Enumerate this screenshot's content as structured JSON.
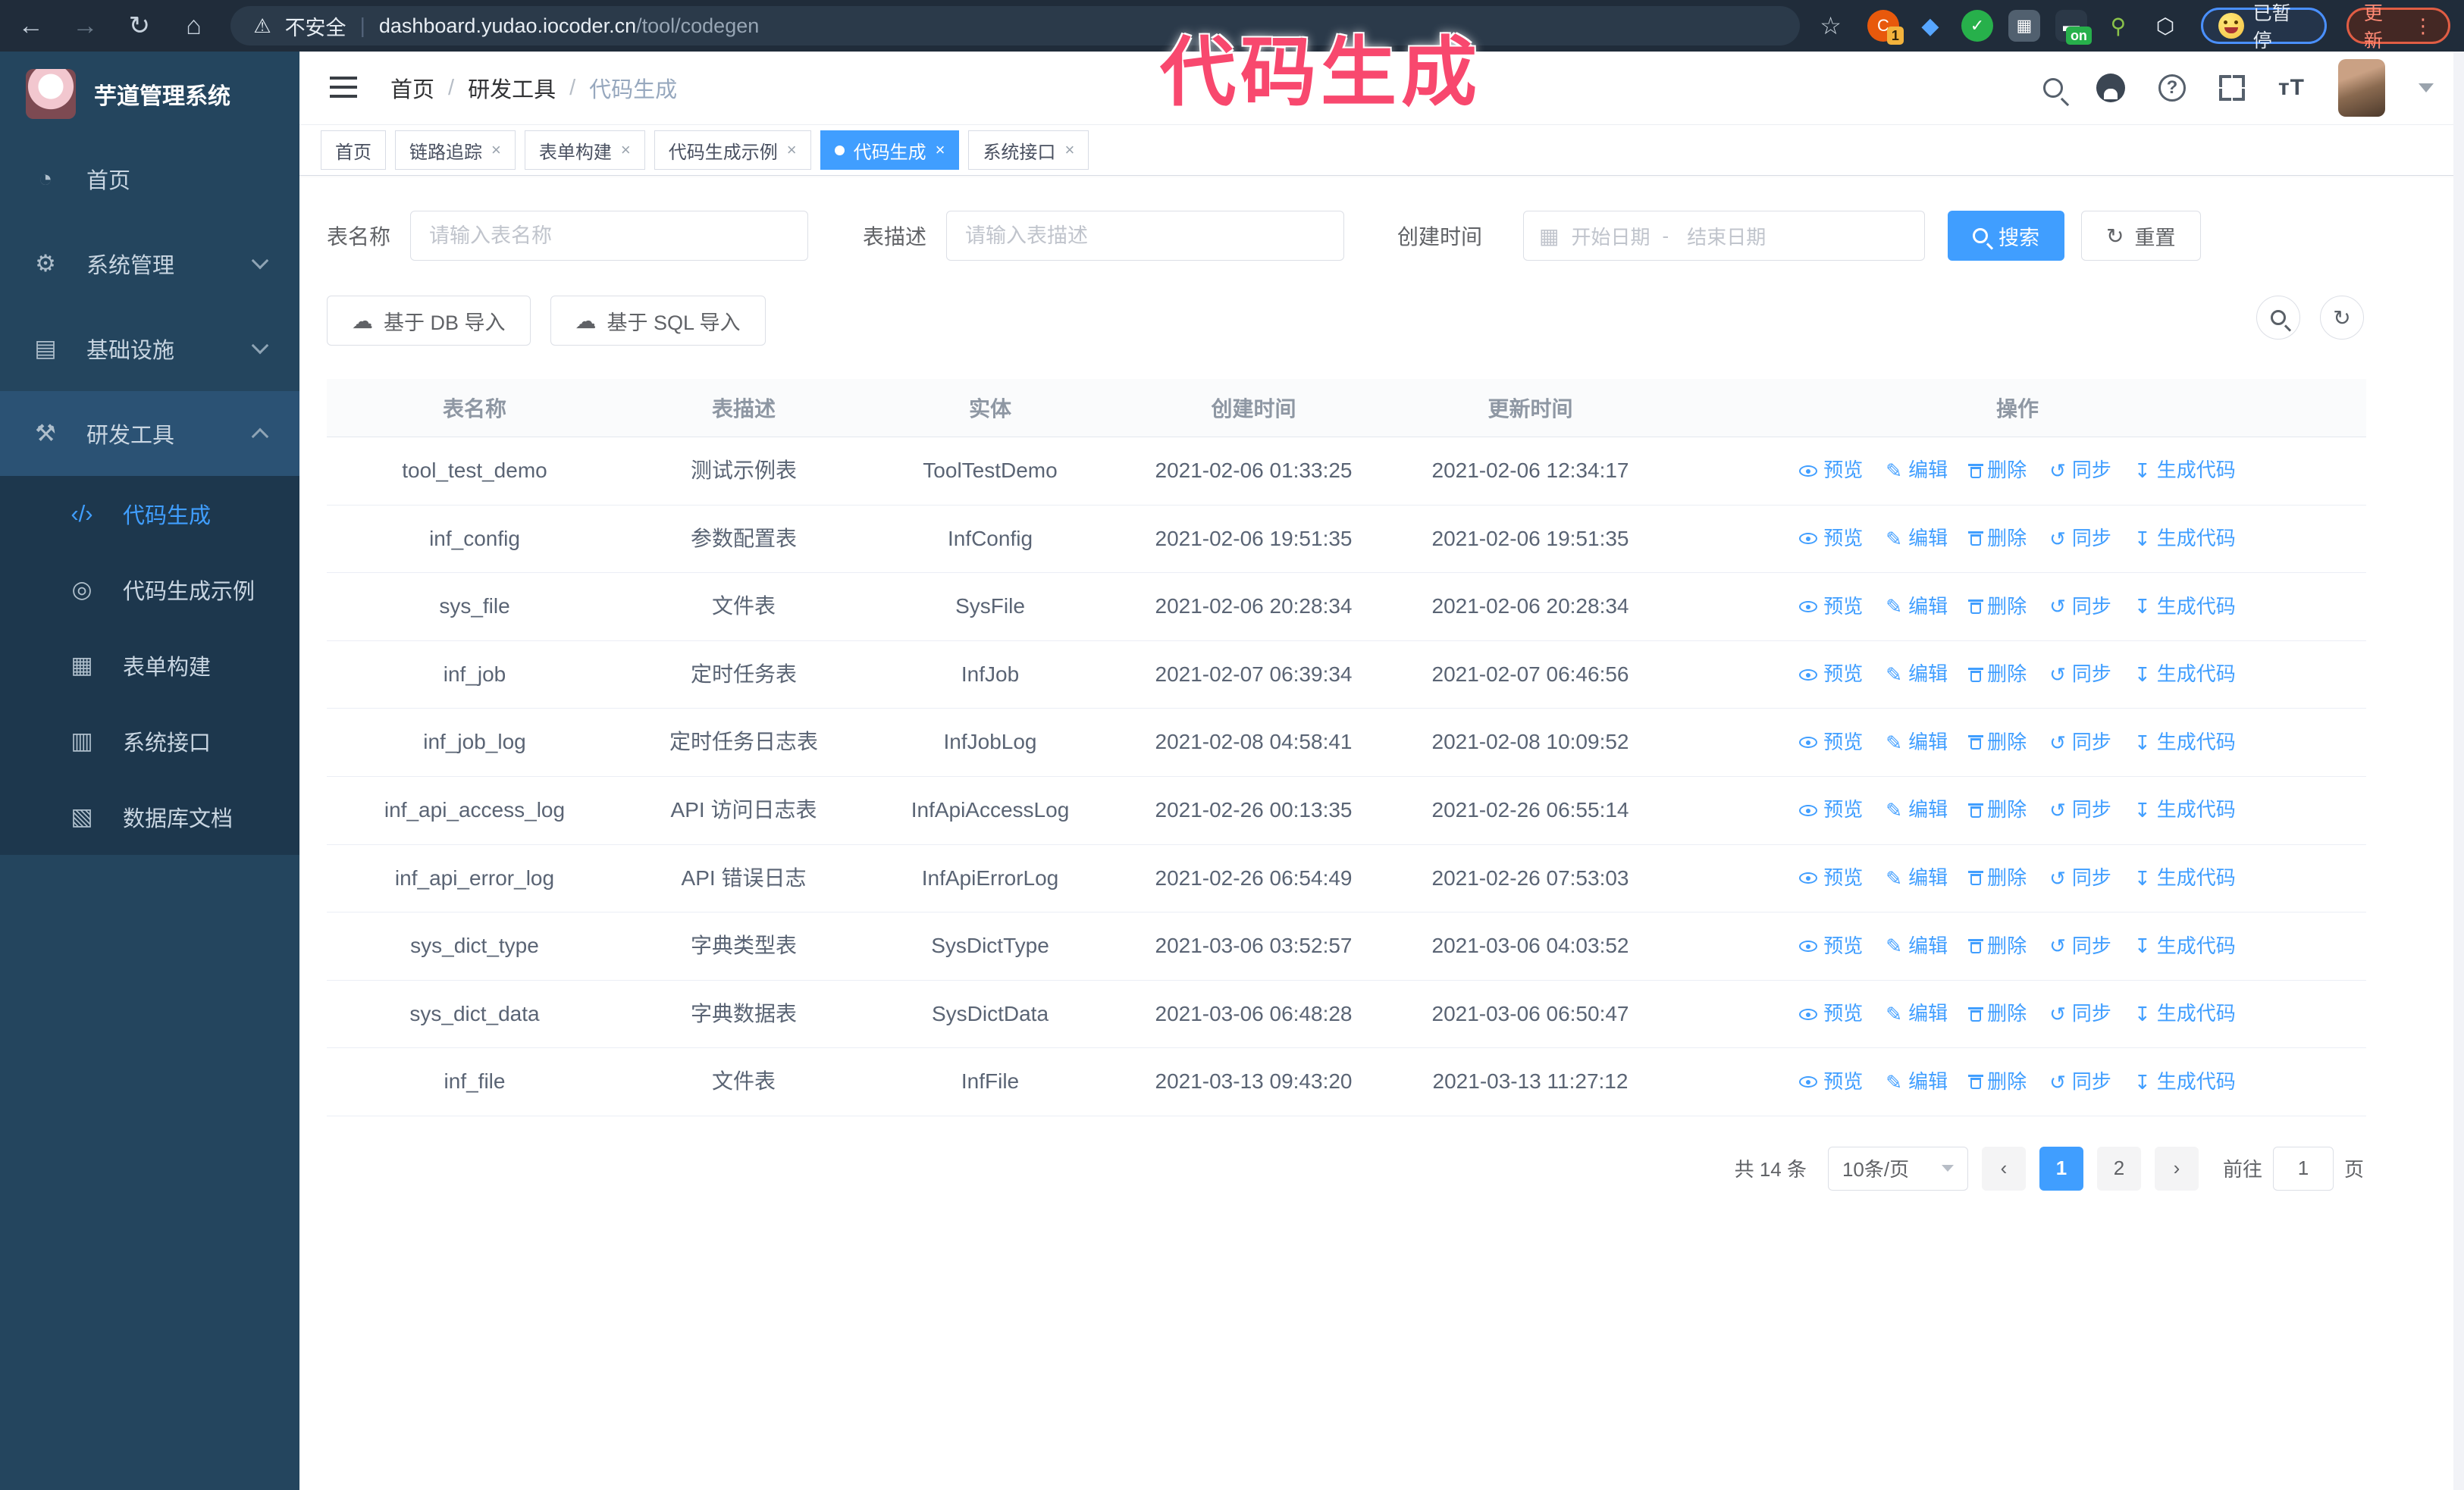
{
  "annotation": "代码生成",
  "browser": {
    "security_label": "不安全",
    "url_host": "dashboard.yudao.iocoder.cn",
    "url_path": "/tool/codegen",
    "extension_badge": "1",
    "extension_on_badge": "on",
    "paused_badge": "已暂停",
    "update_button": "更新"
  },
  "sidebar": {
    "app_title": "芋道管理系统",
    "items": [
      {
        "key": "home",
        "label": "首页",
        "icon": "dashboard-icon",
        "glyph": "◔",
        "chevron": "",
        "open": false
      },
      {
        "key": "system-management",
        "label": "系统管理",
        "icon": "gear-icon",
        "glyph": "⚙",
        "chevron": "down",
        "open": false
      },
      {
        "key": "infrastructure",
        "label": "基础设施",
        "icon": "monitor-icon",
        "glyph": "▤",
        "chevron": "down",
        "open": false
      },
      {
        "key": "dev-tools",
        "label": "研发工具",
        "icon": "toolbox-icon",
        "glyph": "⚒",
        "chevron": "up",
        "open": true
      }
    ],
    "submenu": [
      {
        "key": "codegen",
        "label": "代码生成",
        "icon": "code-icon",
        "glyph": "‹/›",
        "active": true
      },
      {
        "key": "codegen-example",
        "label": "代码生成示例",
        "icon": "example-icon",
        "glyph": "◎",
        "active": false
      },
      {
        "key": "form-builder",
        "label": "表单构建",
        "icon": "form-icon",
        "glyph": "▦",
        "active": false
      },
      {
        "key": "system-api",
        "label": "系统接口",
        "icon": "api-icon",
        "glyph": "▥",
        "active": false
      },
      {
        "key": "db-document",
        "label": "数据库文档",
        "icon": "database-doc-icon",
        "glyph": "▧",
        "active": false
      }
    ]
  },
  "navbar": {
    "breadcrumb": {
      "home": "首页",
      "section": "研发工具",
      "current": "代码生成"
    }
  },
  "tabs": [
    {
      "key": "home",
      "label": "首页",
      "closable": false,
      "active": false
    },
    {
      "key": "trace",
      "label": "链路追踪",
      "closable": true,
      "active": false
    },
    {
      "key": "form-builder",
      "label": "表单构建",
      "closable": true,
      "active": false
    },
    {
      "key": "codegen-example",
      "label": "代码生成示例",
      "closable": true,
      "active": false
    },
    {
      "key": "codegen",
      "label": "代码生成",
      "closable": true,
      "active": true
    },
    {
      "key": "system-api",
      "label": "系统接口",
      "closable": true,
      "active": false
    }
  ],
  "filters": {
    "table_name_label": "表名称",
    "table_name_placeholder": "请输入表名称",
    "table_desc_label": "表描述",
    "table_desc_placeholder": "请输入表描述",
    "created_label": "创建时间",
    "date_start_placeholder": "开始日期",
    "date_separator": "-",
    "date_end_placeholder": "结束日期",
    "search_label": "搜索",
    "reset_label": "重置"
  },
  "toolbar": {
    "import_db_label": "基于 DB 导入",
    "import_sql_label": "基于 SQL 导入"
  },
  "table": {
    "columns": [
      "表名称",
      "表描述",
      "实体",
      "创建时间",
      "更新时间",
      "操作"
    ],
    "action_labels": [
      "预览",
      "编辑",
      "删除",
      "同步",
      "生成代码"
    ],
    "rows": [
      {
        "name": "tool_test_demo",
        "desc": "测试示例表",
        "entity": "ToolTestDemo",
        "created": "2021-02-06 01:33:25",
        "updated": "2021-02-06 12:34:17"
      },
      {
        "name": "inf_config",
        "desc": "参数配置表",
        "entity": "InfConfig",
        "created": "2021-02-06 19:51:35",
        "updated": "2021-02-06 19:51:35"
      },
      {
        "name": "sys_file",
        "desc": "文件表",
        "entity": "SysFile",
        "created": "2021-02-06 20:28:34",
        "updated": "2021-02-06 20:28:34"
      },
      {
        "name": "inf_job",
        "desc": "定时任务表",
        "entity": "InfJob",
        "created": "2021-02-07 06:39:34",
        "updated": "2021-02-07 06:46:56"
      },
      {
        "name": "inf_job_log",
        "desc": "定时任务日志表",
        "entity": "InfJobLog",
        "created": "2021-02-08 04:58:41",
        "updated": "2021-02-08 10:09:52"
      },
      {
        "name": "inf_api_access_log",
        "desc": "API 访问日志表",
        "entity": "InfApiAccessLog",
        "created": "2021-02-26 00:13:35",
        "updated": "2021-02-26 06:55:14"
      },
      {
        "name": "inf_api_error_log",
        "desc": "API 错误日志",
        "entity": "InfApiErrorLog",
        "created": "2021-02-26 06:54:49",
        "updated": "2021-02-26 07:53:03"
      },
      {
        "name": "sys_dict_type",
        "desc": "字典类型表",
        "entity": "SysDictType",
        "created": "2021-03-06 03:52:57",
        "updated": "2021-03-06 04:03:52"
      },
      {
        "name": "sys_dict_data",
        "desc": "字典数据表",
        "entity": "SysDictData",
        "created": "2021-03-06 06:48:28",
        "updated": "2021-03-06 06:50:47"
      },
      {
        "name": "inf_file",
        "desc": "文件表",
        "entity": "InfFile",
        "created": "2021-03-13 09:43:20",
        "updated": "2021-03-13 11:27:12"
      }
    ]
  },
  "pagination": {
    "total_text": "共 14 条",
    "page_size": "10条/页",
    "pages": [
      "1",
      "2"
    ],
    "current_page": "1",
    "goto_label": "前往",
    "goto_value": "1",
    "page_suffix": "页"
  },
  "colors": {
    "primary": "#409eff",
    "sidebar_bg": "#24455e",
    "submenu_bg": "#1d374d",
    "browser_bar_bg": "#202c3a",
    "annotation_pink": "#f8486e",
    "update_red": "#ff8a75",
    "paused_border_blue": "#4a90ff"
  }
}
